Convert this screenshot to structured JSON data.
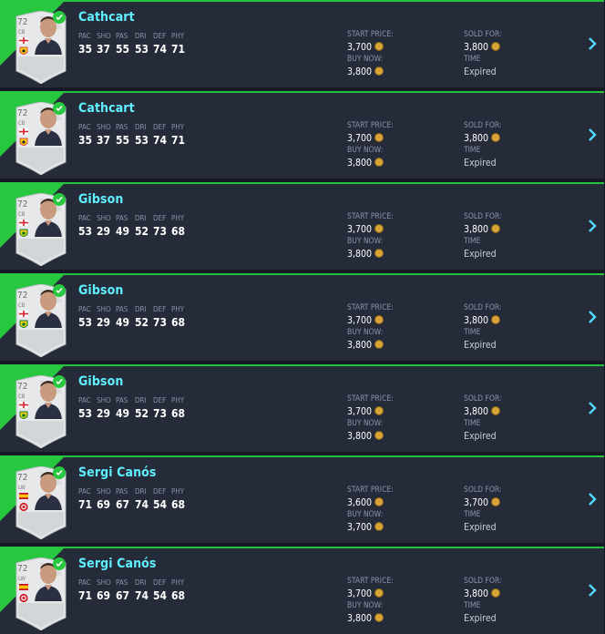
{
  "colors": {
    "accent_green": "#27c840",
    "name_cyan": "#5ff0ff",
    "row_bg": "#262b39",
    "chevron": "#4fd9ff"
  },
  "labels": {
    "start_price": "START PRICE:",
    "buy_now": "BUY NOW:",
    "sold_for": "SOLD FOR:",
    "time": "TIME"
  },
  "stat_labels": [
    "PAC",
    "SHO",
    "PAS",
    "DRI",
    "DEF",
    "PHY"
  ],
  "rows": [
    {
      "name": "Cathcart",
      "rating": "72",
      "position": "CB",
      "flag": "england",
      "club": "watford",
      "stats": [
        "35",
        "37",
        "55",
        "53",
        "74",
        "71"
      ],
      "start_price": "3,700",
      "buy_now": "3,800",
      "sold_for": "3,800",
      "time": "Expired"
    },
    {
      "name": "Cathcart",
      "rating": "72",
      "position": "CB",
      "flag": "england",
      "club": "watford",
      "stats": [
        "35",
        "37",
        "55",
        "53",
        "74",
        "71"
      ],
      "start_price": "3,700",
      "buy_now": "3,800",
      "sold_for": "3,800",
      "time": "Expired"
    },
    {
      "name": "Gibson",
      "rating": "72",
      "position": "CB",
      "flag": "england",
      "club": "norwich",
      "stats": [
        "53",
        "29",
        "49",
        "52",
        "73",
        "68"
      ],
      "start_price": "3,700",
      "buy_now": "3,800",
      "sold_for": "3,800",
      "time": "Expired"
    },
    {
      "name": "Gibson",
      "rating": "72",
      "position": "CB",
      "flag": "england",
      "club": "norwich",
      "stats": [
        "53",
        "29",
        "49",
        "52",
        "73",
        "68"
      ],
      "start_price": "3,700",
      "buy_now": "3,800",
      "sold_for": "3,800",
      "time": "Expired"
    },
    {
      "name": "Gibson",
      "rating": "72",
      "position": "CB",
      "flag": "england",
      "club": "norwich",
      "stats": [
        "53",
        "29",
        "49",
        "52",
        "73",
        "68"
      ],
      "start_price": "3,700",
      "buy_now": "3,800",
      "sold_for": "3,800",
      "time": "Expired"
    },
    {
      "name": "Sergi Canós",
      "rating": "72",
      "position": "LW",
      "flag": "spain",
      "club": "brentford",
      "stats": [
        "71",
        "69",
        "67",
        "74",
        "54",
        "68"
      ],
      "start_price": "3,600",
      "buy_now": "3,700",
      "sold_for": "3,700",
      "time": "Expired"
    },
    {
      "name": "Sergi Canós",
      "rating": "72",
      "position": "LW",
      "flag": "spain",
      "club": "brentford",
      "stats": [
        "71",
        "69",
        "67",
        "74",
        "54",
        "68"
      ],
      "start_price": "3,700",
      "buy_now": "3,800",
      "sold_for": "3,800",
      "time": "Expired"
    }
  ]
}
